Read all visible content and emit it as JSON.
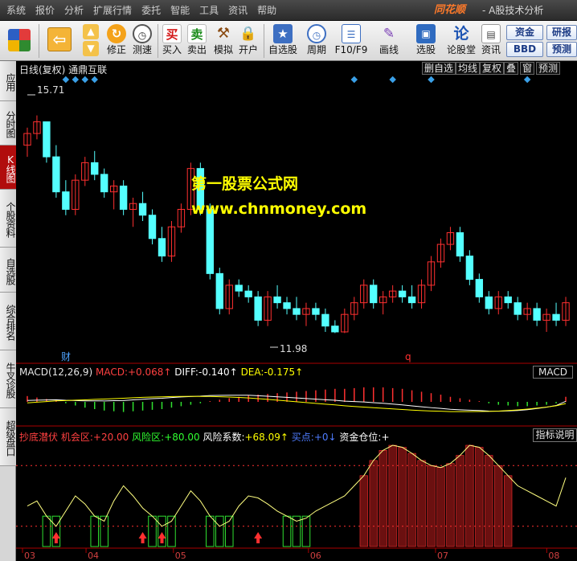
{
  "menu": [
    "系统",
    "报价",
    "分析",
    "扩展行情",
    "委托",
    "智能",
    "工具",
    "资讯",
    "帮助"
  ],
  "brand": "同花顺",
  "app_title": "- A股技术分析",
  "toolbar": {
    "buttons": [
      {
        "label": "修正",
        "icon": "refresh-icon"
      },
      {
        "label": "测速",
        "icon": "clock-icon"
      },
      {
        "label": "买入",
        "icon": "buy-icon",
        "glyph": "买"
      },
      {
        "label": "卖出",
        "icon": "sell-icon",
        "glyph": "卖"
      },
      {
        "label": "模拟",
        "icon": "hammer-icon"
      },
      {
        "label": "开户",
        "icon": "lock-icon"
      },
      {
        "label": "自选股",
        "icon": "star-icon"
      },
      {
        "label": "周期",
        "icon": "clock-cycle-icon"
      },
      {
        "label": "F10/F9",
        "icon": "document-icon"
      },
      {
        "label": "画线",
        "icon": "pen-icon"
      },
      {
        "label": "选股",
        "icon": "screen-icon"
      },
      {
        "label": "论股堂",
        "icon": "forum-icon",
        "glyph": "论"
      },
      {
        "label": "资讯",
        "icon": "news-icon"
      }
    ],
    "right_buttons": [
      "资金",
      "研报",
      "BBD",
      "预测"
    ]
  },
  "left_tabs": [
    {
      "label": "应用",
      "active": false
    },
    {
      "label": "分时图",
      "active": false
    },
    {
      "label": "K线图",
      "active": true
    },
    {
      "label": "个股资料",
      "active": false
    },
    {
      "label": "自选股",
      "active": false
    },
    {
      "label": "综合排名",
      "active": false
    },
    {
      "label": "牛叉诊股",
      "active": false
    },
    {
      "label": "超级盘口",
      "active": false
    }
  ],
  "chart": {
    "title": "日线(复权)  通鼎互联",
    "header_buttons": [
      "删自选",
      "均线",
      "复权",
      "叠",
      "窗",
      "预测"
    ],
    "high_label": "15.71",
    "low_label": "11.98",
    "markers": [
      "财",
      "q"
    ],
    "watermark_title": "第一股票公式网",
    "watermark_url": "www.chnmoney.com"
  },
  "macd": {
    "name": "MACD(12,26,9)",
    "macd_label": "MACD:",
    "macd_value": "+0.068↑",
    "diff_label": "DIFF:",
    "diff_value": "-0.140↑",
    "dea_label": "DEA:",
    "dea_value": "-0.175↑",
    "tag": "MACD"
  },
  "indicator": {
    "name": "抄底潜伏",
    "opportunity_label": "机会区:",
    "opportunity_value": "+20.00",
    "risk_zone_label": "风险区:",
    "risk_zone_value": "+80.00",
    "risk_coef_label": "风险系数:",
    "risk_coef_value": "+68.09↑",
    "buy_label": "买点:",
    "buy_value": "+0↓",
    "position_label": "资金仓位:",
    "position_value": "+",
    "help": "指标说明"
  },
  "x_axis": [
    "03",
    "04",
    "05",
    "06",
    "07",
    "08"
  ],
  "colors": {
    "up": "#ff3030",
    "down": "#54ffff",
    "accent_red": "#b10d0d",
    "watermark": "#ffff00",
    "diff_line": "#ffffff",
    "dea_line": "#ffff00",
    "zone_dot": "#ff3030"
  },
  "chart_data": {
    "type": "candlestick",
    "price_range": [
      11.6,
      16.2
    ],
    "candles": [
      [
        15.2,
        15.5,
        15.0,
        15.4
      ],
      [
        15.4,
        15.71,
        15.3,
        15.6
      ],
      [
        15.6,
        15.6,
        14.9,
        15.0
      ],
      [
        15.0,
        15.2,
        14.3,
        14.4
      ],
      [
        14.4,
        14.6,
        14.0,
        14.1
      ],
      [
        14.1,
        14.7,
        14.0,
        14.6
      ],
      [
        14.6,
        15.0,
        14.5,
        14.9
      ],
      [
        14.9,
        15.1,
        14.6,
        14.7
      ],
      [
        14.7,
        14.8,
        14.3,
        14.4
      ],
      [
        14.4,
        14.6,
        14.1,
        14.5
      ],
      [
        14.5,
        14.6,
        14.0,
        14.1
      ],
      [
        14.1,
        14.3,
        13.8,
        14.2
      ],
      [
        14.2,
        14.4,
        13.9,
        14.0
      ],
      [
        14.0,
        14.1,
        13.5,
        13.6
      ],
      [
        13.6,
        13.8,
        13.2,
        13.3
      ],
      [
        13.3,
        13.9,
        13.2,
        13.8
      ],
      [
        13.8,
        14.2,
        13.7,
        14.1
      ],
      [
        14.1,
        14.9,
        14.0,
        14.8
      ],
      [
        14.8,
        14.9,
        14.0,
        14.1
      ],
      [
        14.1,
        14.2,
        12.9,
        13.0
      ],
      [
        13.0,
        13.1,
        12.3,
        12.4
      ],
      [
        12.4,
        12.9,
        12.3,
        12.8
      ],
      [
        12.8,
        12.9,
        12.6,
        12.7
      ],
      [
        12.7,
        12.8,
        12.5,
        12.6
      ],
      [
        12.6,
        12.7,
        12.1,
        12.2
      ],
      [
        12.2,
        12.7,
        12.1,
        12.6
      ],
      [
        12.6,
        12.8,
        12.4,
        12.5
      ],
      [
        12.5,
        12.6,
        12.3,
        12.4
      ],
      [
        12.4,
        12.6,
        12.2,
        12.3
      ],
      [
        12.3,
        12.5,
        12.1,
        12.4
      ],
      [
        12.4,
        12.5,
        12.2,
        12.3
      ],
      [
        12.3,
        12.4,
        12.0,
        12.1
      ],
      [
        12.1,
        12.2,
        11.98,
        12.0
      ],
      [
        12.0,
        12.4,
        11.98,
        12.3
      ],
      [
        12.3,
        12.6,
        12.2,
        12.5
      ],
      [
        12.5,
        12.9,
        12.4,
        12.8
      ],
      [
        12.8,
        12.9,
        12.4,
        12.5
      ],
      [
        12.5,
        12.7,
        12.3,
        12.6
      ],
      [
        12.6,
        12.8,
        12.5,
        12.7
      ],
      [
        12.7,
        12.8,
        12.5,
        12.6
      ],
      [
        12.6,
        12.8,
        12.4,
        12.5
      ],
      [
        12.5,
        12.9,
        12.4,
        12.8
      ],
      [
        12.8,
        13.3,
        12.7,
        13.2
      ],
      [
        13.2,
        13.6,
        13.1,
        13.5
      ],
      [
        13.5,
        13.8,
        13.4,
        13.7
      ],
      [
        13.7,
        13.8,
        13.2,
        13.3
      ],
      [
        13.3,
        13.4,
        12.8,
        12.9
      ],
      [
        12.9,
        13.0,
        12.5,
        12.6
      ],
      [
        12.6,
        12.7,
        12.3,
        12.4
      ],
      [
        12.4,
        12.7,
        12.3,
        12.6
      ],
      [
        12.6,
        12.7,
        12.4,
        12.5
      ],
      [
        12.5,
        12.6,
        12.2,
        12.3
      ],
      [
        12.3,
        12.5,
        12.2,
        12.4
      ],
      [
        12.4,
        12.5,
        12.1,
        12.2
      ],
      [
        12.2,
        12.4,
        12.0,
        12.3
      ],
      [
        12.3,
        12.5,
        12.1,
        12.2
      ],
      [
        12.2,
        12.6,
        12.1,
        12.5
      ]
    ],
    "macd_hist": [
      0.08,
      0.06,
      0.04,
      0.02,
      -0.02,
      -0.05,
      -0.08,
      -0.1,
      -0.12,
      -0.13,
      -0.14,
      -0.13,
      -0.12,
      -0.11,
      -0.1,
      -0.08,
      -0.06,
      -0.04,
      -0.02,
      0.01,
      0.03,
      0.05,
      0.07,
      0.09,
      0.1,
      0.11,
      0.12,
      0.13,
      0.14,
      0.15,
      0.16,
      0.17,
      0.18,
      0.18,
      0.19,
      0.2,
      0.2,
      0.2,
      0.19,
      0.18,
      0.16,
      0.14,
      0.12,
      0.1,
      0.07,
      0.05,
      0.03,
      0.01,
      -0.02,
      -0.04,
      -0.05,
      -0.06,
      -0.06,
      -0.05,
      -0.04,
      -0.02,
      0.07
    ],
    "indicator_line": [
      40,
      45,
      30,
      20,
      35,
      50,
      42,
      30,
      25,
      45,
      60,
      50,
      38,
      30,
      20,
      25,
      40,
      55,
      45,
      30,
      20,
      25,
      40,
      50,
      48,
      42,
      35,
      30,
      25,
      28,
      35,
      40,
      45,
      50,
      60,
      70,
      85,
      95,
      100,
      98,
      92,
      85,
      80,
      78,
      82,
      90,
      100,
      98,
      90,
      80,
      70,
      60,
      55,
      50,
      45,
      40,
      68
    ]
  }
}
